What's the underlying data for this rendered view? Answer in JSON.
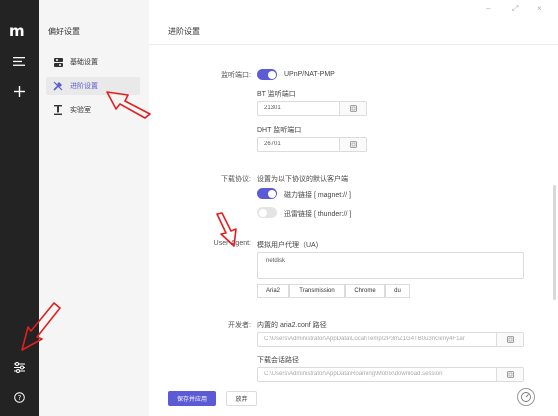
{
  "rail": {
    "logo": "m",
    "icons": [
      "menu-icon",
      "plus-icon",
      "settings-sliders-icon",
      "help-icon"
    ]
  },
  "sidebar": {
    "title": "偏好设置",
    "items": [
      {
        "label": "基础设置",
        "icon": "basic-settings-icon"
      },
      {
        "label": "进阶设置",
        "icon": "advanced-settings-icon",
        "active": true
      },
      {
        "label": "实验室",
        "icon": "lab-icon"
      }
    ]
  },
  "main": {
    "title": "进阶设置",
    "listen_port": {
      "label": "监听端口:",
      "upnp_label": "UPnP/NAT-PMP",
      "bt_label": "BT 监听端口",
      "bt_value": "21301",
      "dht_label": "DHT 监听端口",
      "dht_value": "26701"
    },
    "download_protocol": {
      "label": "下载协议:",
      "description": "设置为以下协议的默认客户端",
      "magnet_label": "磁力链接 [ magnet:// ]",
      "thunder_label": "迅雷链接 [ thunder:// ]"
    },
    "user_agent": {
      "label": "User-Agent:",
      "description": "模拟用户代理（UA)",
      "value": "netdisk",
      "presets": [
        "Aria2",
        "Transmission",
        "Chrome",
        "du"
      ]
    },
    "developer": {
      "label": "开发者:",
      "conf_label": "内置的 aria2.conf 路径",
      "conf_path": "C:\\Users\\Administrator\\AppData\\Local\\Temp\\2P3mZ1G4TB0u3nGimy4F1ar",
      "session_label": "下载会话路径",
      "session_path": "C:\\Users\\Administrator\\AppData\\Roaming\\Motrix\\download.session"
    },
    "save_button": "保存并应用",
    "discard_button": "放弃"
  },
  "colors": {
    "accent": "#5b5bd6",
    "rail_bg": "#232323",
    "sidebar_bg": "#f5f5f5",
    "annotation_arrow": "#e02020"
  }
}
